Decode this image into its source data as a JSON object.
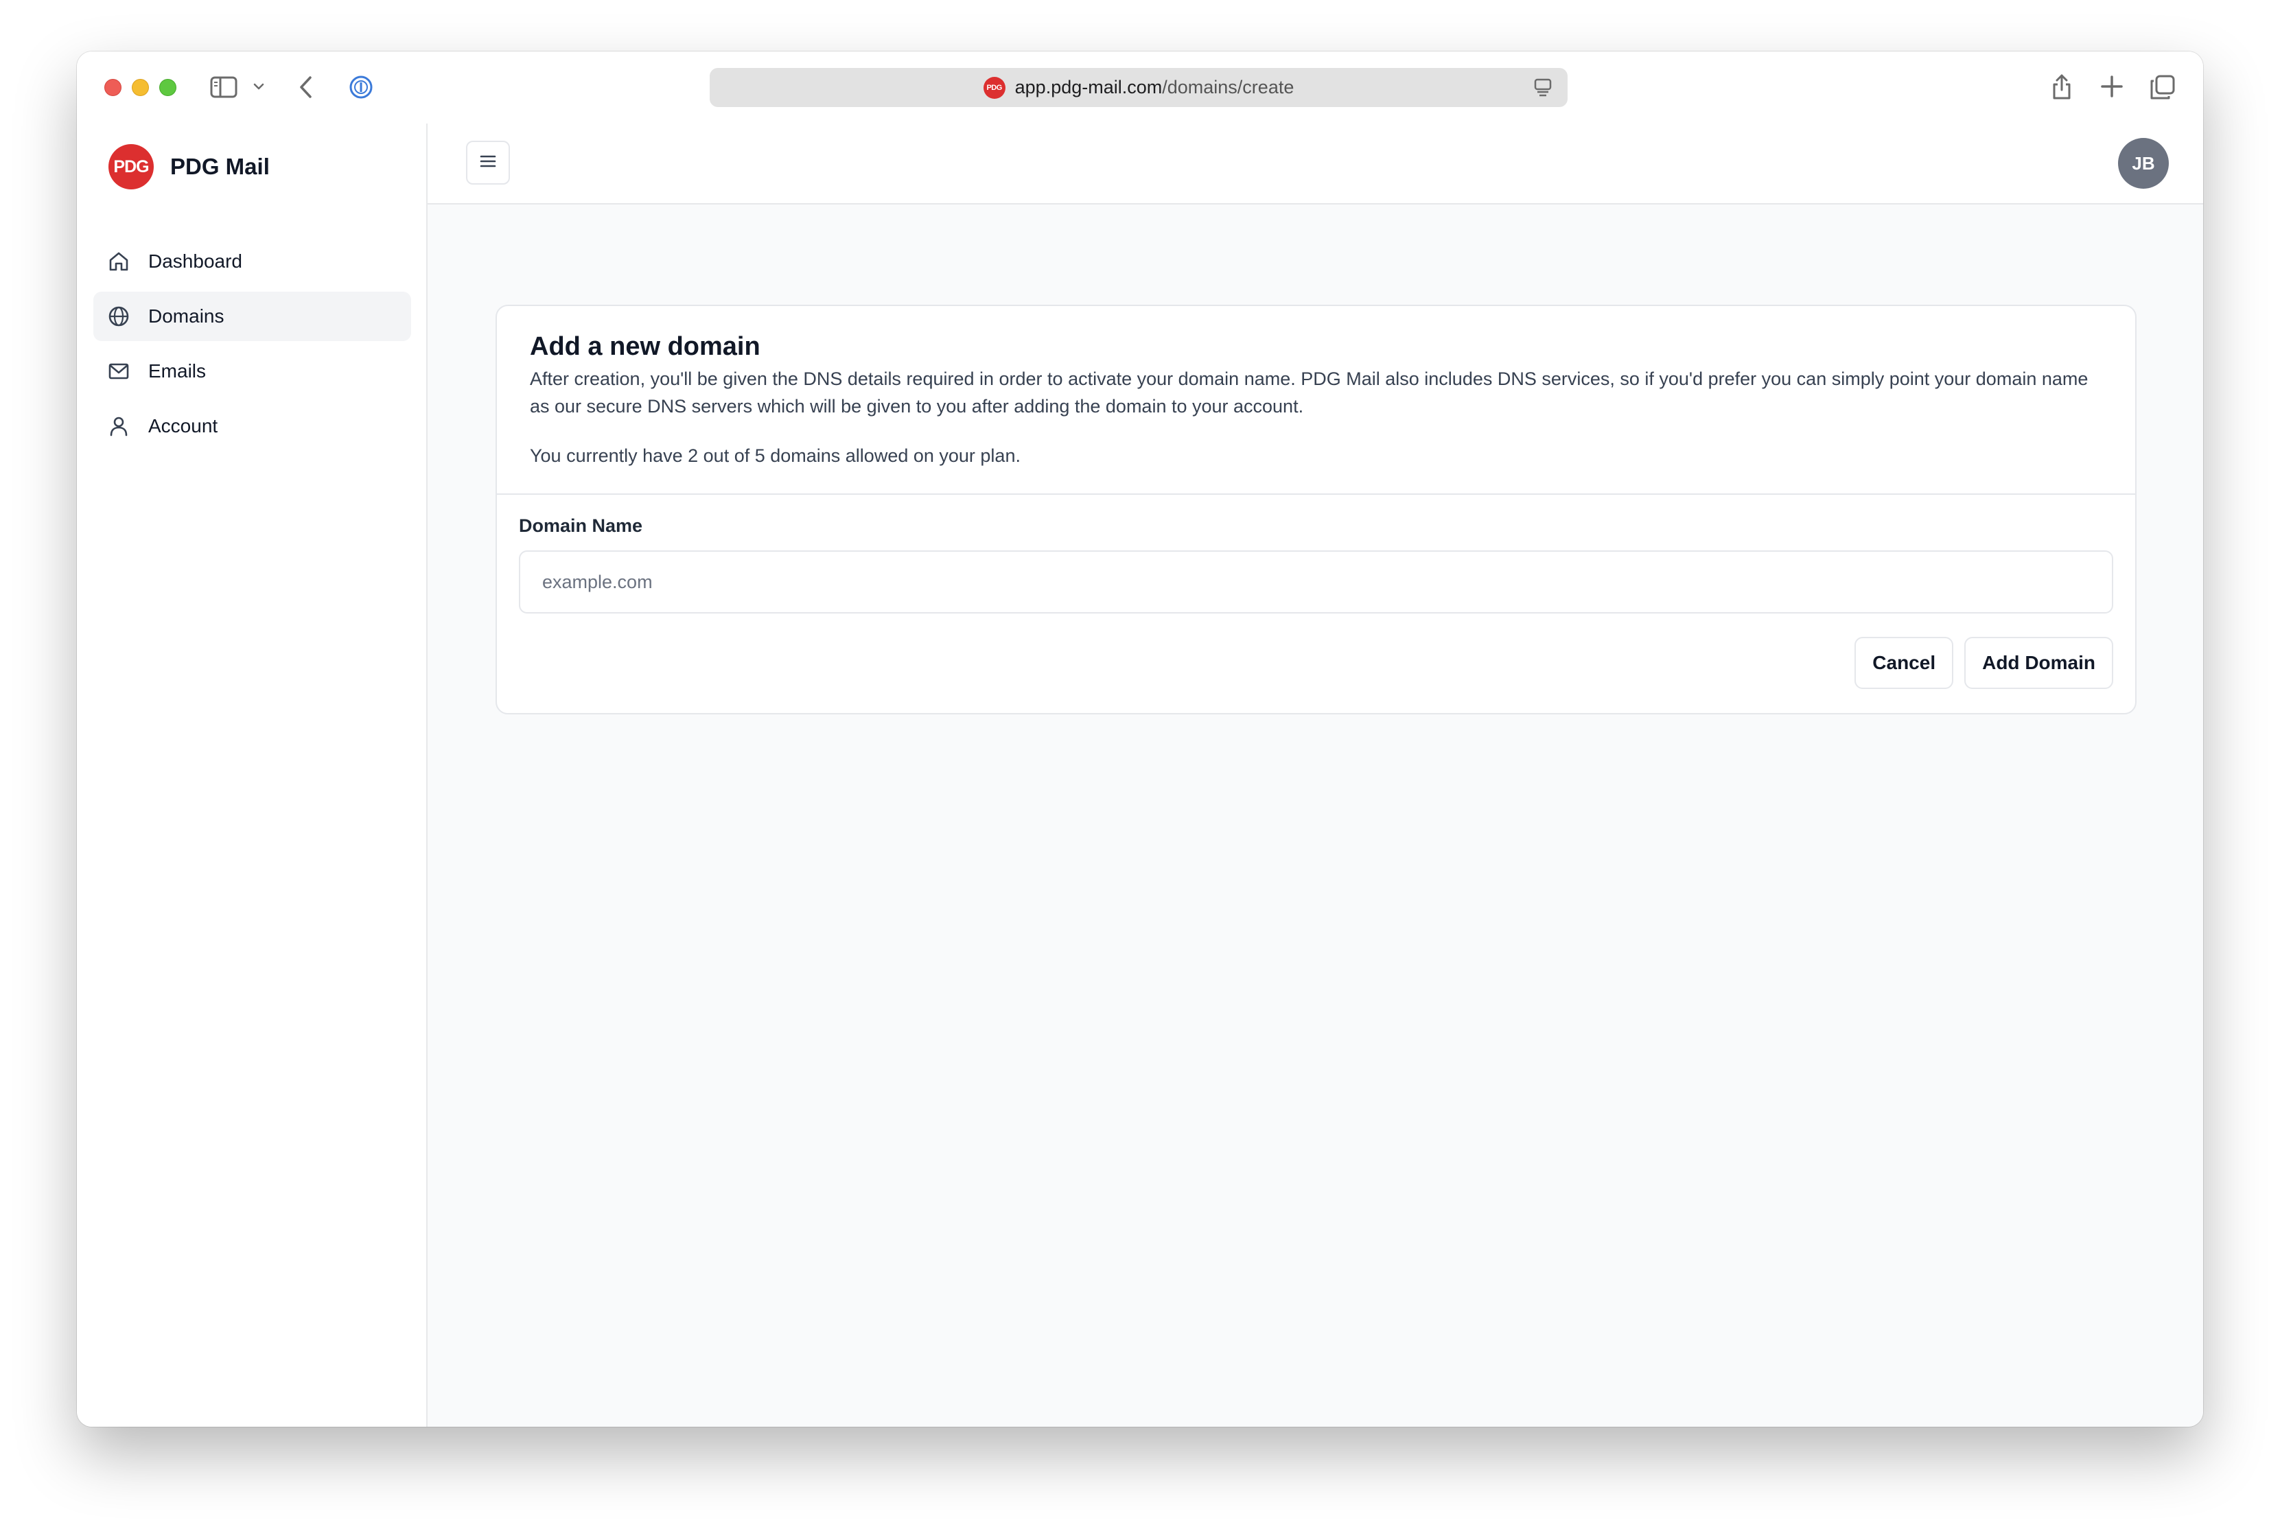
{
  "browser": {
    "url_host": "app.pdg-mail.com",
    "url_path": "/domains/create",
    "favicon_text": "PDG"
  },
  "sidebar": {
    "brand": {
      "logo_text": "PDG",
      "name": "PDG Mail"
    },
    "items": [
      {
        "label": "Dashboard",
        "icon": "home-icon",
        "active": false
      },
      {
        "label": "Domains",
        "icon": "globe-icon",
        "active": true
      },
      {
        "label": "Emails",
        "icon": "mail-icon",
        "active": false
      },
      {
        "label": "Account",
        "icon": "user-icon",
        "active": false
      }
    ]
  },
  "topbar": {
    "avatar_initials": "JB"
  },
  "card": {
    "title": "Add a new domain",
    "description": "After creation, you'll be given the DNS details required in order to activate your domain name. PDG Mail also includes DNS services, so if you'd prefer you can simply point your domain name as our secure DNS servers which will be given to you after adding the domain to your account.",
    "note": "You currently have 2 out of 5 domains allowed on your plan.",
    "field": {
      "label": "Domain Name",
      "value": "",
      "placeholder": "example.com"
    },
    "cancel_label": "Cancel",
    "submit_label": "Add Domain"
  },
  "colors": {
    "brand": "#dc2f2f",
    "avatar": "#6b7280",
    "active_nav_bg": "#f3f4f6",
    "main_bg": "#f9fafb"
  }
}
